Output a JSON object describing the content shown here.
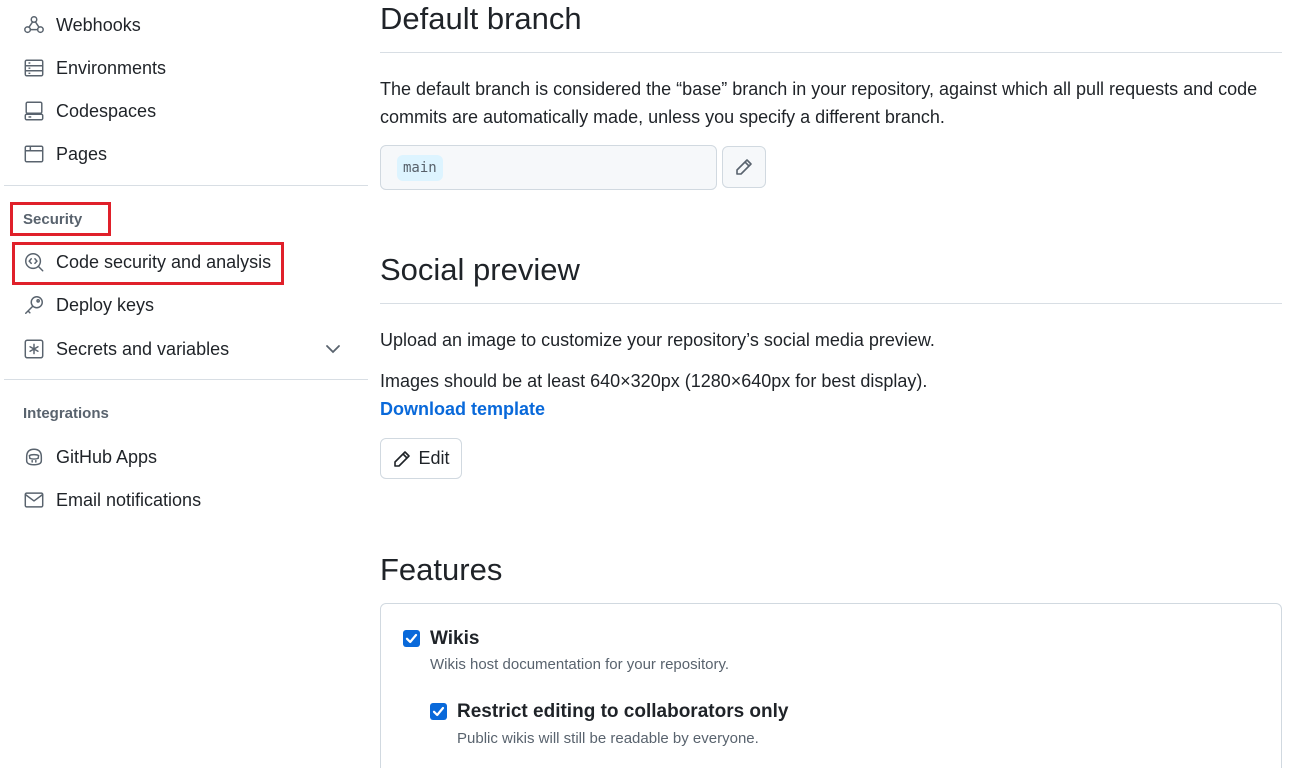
{
  "sidebar": {
    "items_top": [
      {
        "label": "Webhooks",
        "icon": "webhook-icon"
      },
      {
        "label": "Environments",
        "icon": "server-icon"
      },
      {
        "label": "Codespaces",
        "icon": "codespaces-icon"
      },
      {
        "label": "Pages",
        "icon": "browser-icon"
      }
    ],
    "security_heading": "Security",
    "security_items": [
      {
        "label": "Code security and analysis",
        "icon": "codescan-icon"
      },
      {
        "label": "Deploy keys",
        "icon": "key-icon"
      },
      {
        "label": "Secrets and variables",
        "icon": "asterisk-icon"
      }
    ],
    "integrations_heading": "Integrations",
    "integration_items": [
      {
        "label": "GitHub Apps",
        "icon": "copilot-icon"
      },
      {
        "label": "Email notifications",
        "icon": "mail-icon"
      }
    ],
    "highlight_color": "#e0202a"
  },
  "main": {
    "default_branch": {
      "title": "Default branch",
      "description": "The default branch is considered the “base” branch in your repository, against which all pull requests and code commits are automatically made, unless you specify a different branch.",
      "branch_name": "main"
    },
    "social_preview": {
      "title": "Social preview",
      "description": "Upload an image to customize your repository’s social media preview.",
      "size_note": "Images should be at least 640×320px (1280×640px for best display).",
      "download_link": "Download template",
      "edit_label": "Edit"
    },
    "features": {
      "title": "Features",
      "wikis_label": "Wikis",
      "wikis_checked": true,
      "wikis_description": "Wikis host documentation for your repository.",
      "restrict_label": "Restrict editing to collaborators only",
      "restrict_checked": true,
      "restrict_description": "Public wikis will still be readable by everyone."
    }
  },
  "colors": {
    "accent": "#0969da",
    "border": "#d1d9e0",
    "muted_text": "#59636e"
  }
}
